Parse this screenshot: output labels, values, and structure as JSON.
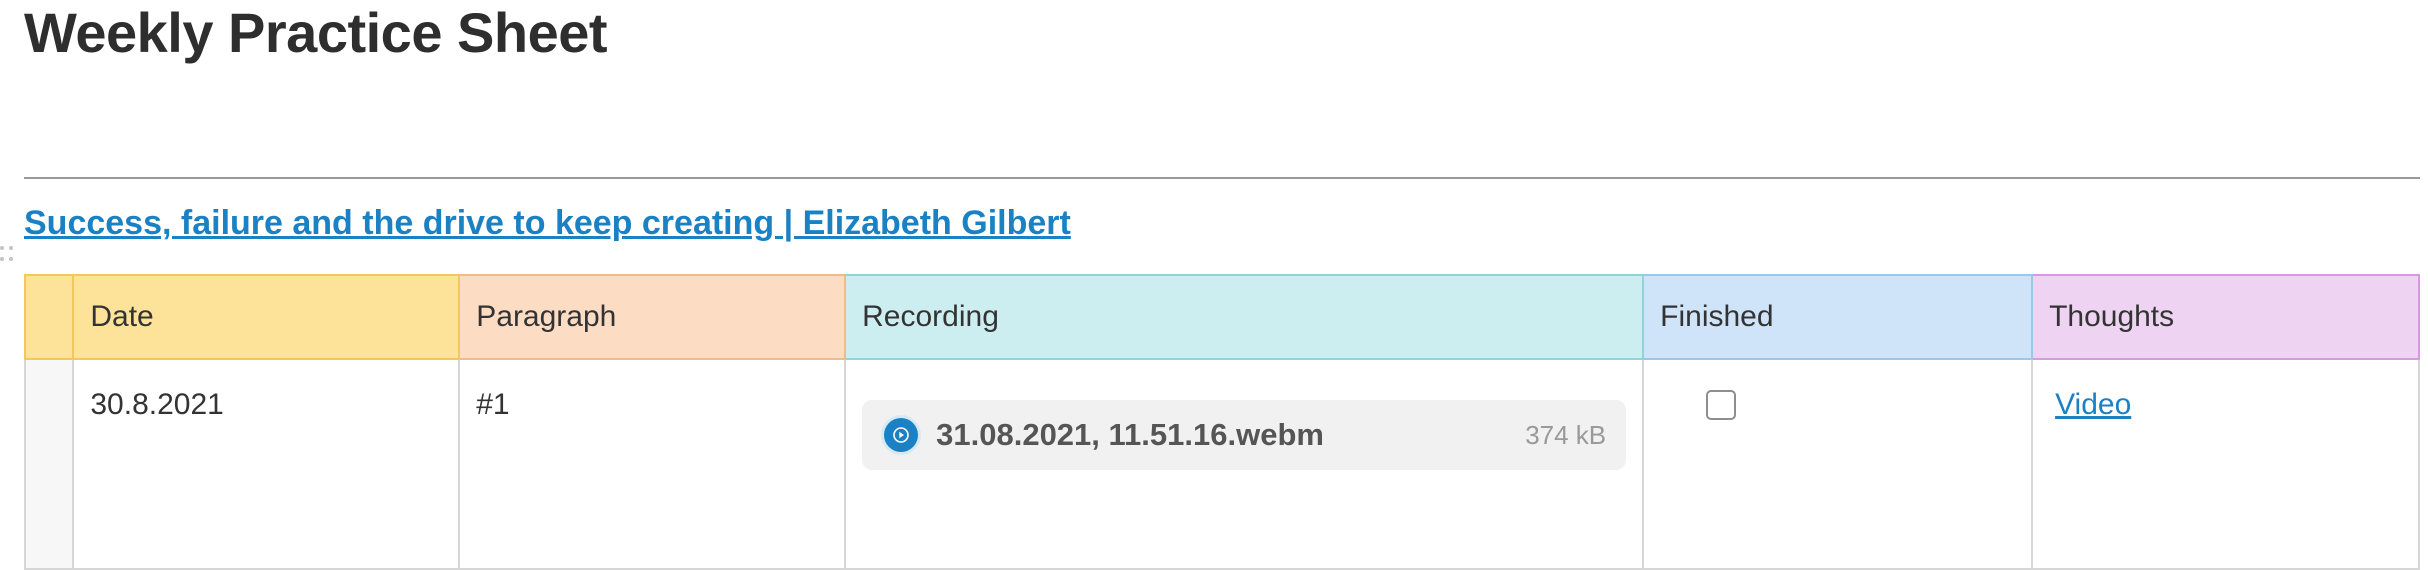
{
  "page": {
    "title": "Weekly Practice Sheet",
    "link_title": "Success, failure and the drive to keep creating | Elizabeth Gilbert"
  },
  "table": {
    "columns": [
      "Date",
      "Paragraph",
      "Recording",
      "Finished",
      "Thoughts"
    ],
    "rows": [
      {
        "date": "30.8.2021",
        "paragraph": "#1",
        "recording": {
          "file_name": "31.08.2021, 11.51.16.webm",
          "file_size": "374 kB",
          "icon": "play-icon"
        },
        "finished": false,
        "thoughts": "Video"
      }
    ]
  },
  "colors": {
    "link": "#1a82c4",
    "date_header": "#fde39a",
    "paragraph_header": "#fddcc4",
    "recording_header": "#cdeef0",
    "finished_header": "#cfe4f8",
    "thoughts_header": "#efd3f3"
  }
}
